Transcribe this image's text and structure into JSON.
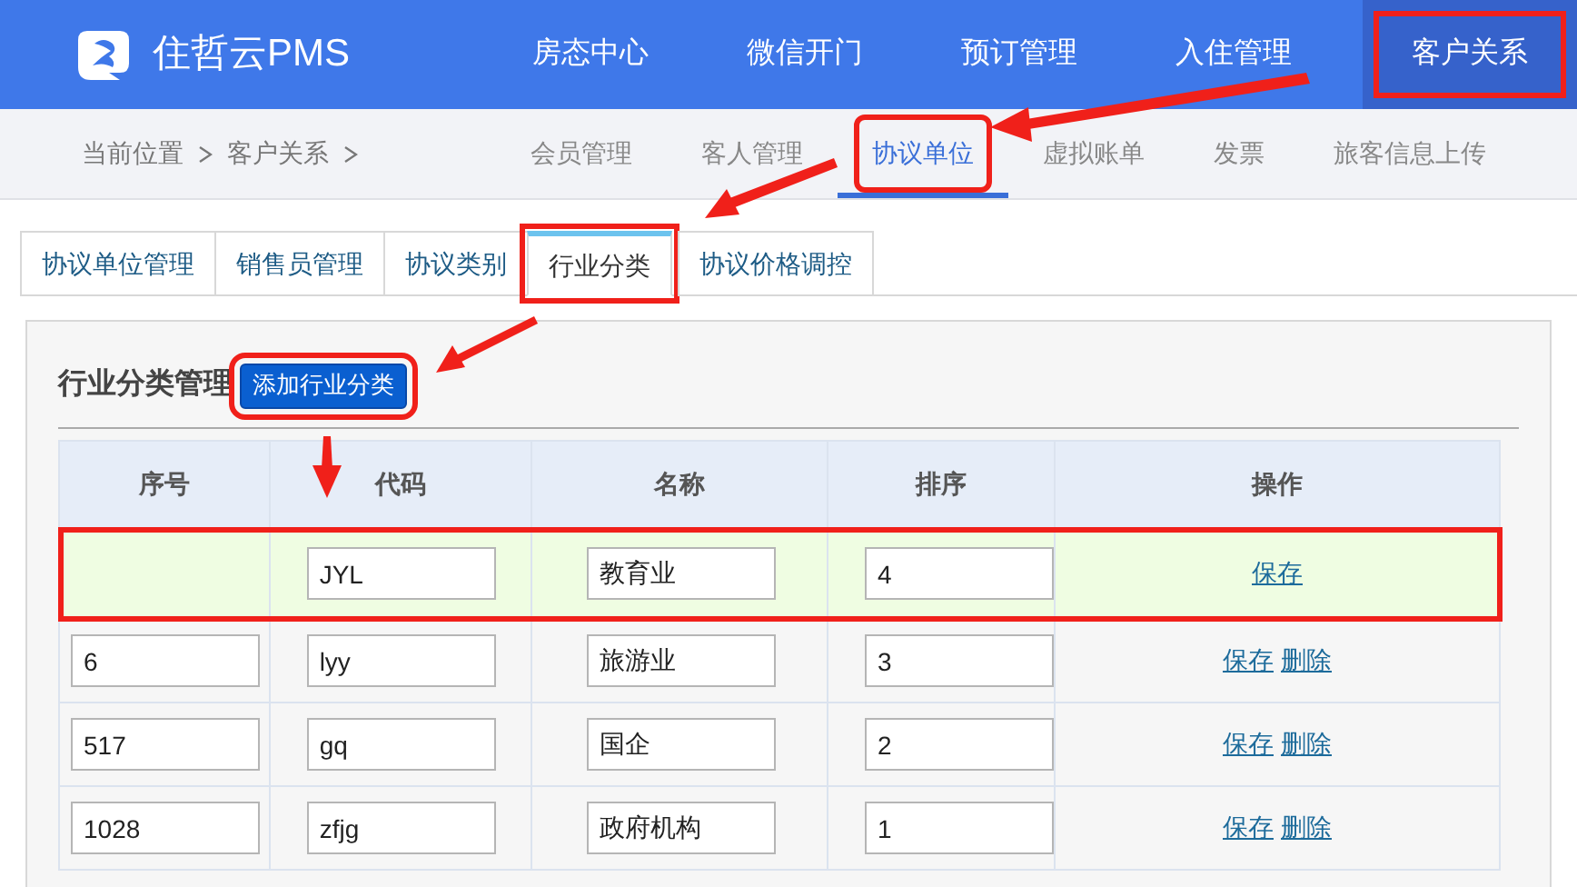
{
  "brand": {
    "name": "住哲云PMS"
  },
  "nav": [
    {
      "label": "房态中心",
      "selected": false,
      "annotated": false
    },
    {
      "label": "微信开门",
      "selected": false,
      "annotated": false
    },
    {
      "label": "预订管理",
      "selected": false,
      "annotated": false
    },
    {
      "label": "入住管理",
      "selected": false,
      "annotated": false
    },
    {
      "label": "客户关系",
      "selected": true,
      "annotated": true
    }
  ],
  "breadcrumb": [
    "当前位置",
    "客户关系"
  ],
  "subnav": [
    {
      "label": "会员管理",
      "selected": false,
      "annotated": false
    },
    {
      "label": "客人管理",
      "selected": false,
      "annotated": false
    },
    {
      "label": "协议单位",
      "selected": true,
      "annotated": true
    },
    {
      "label": "虚拟账单",
      "selected": false,
      "annotated": false
    },
    {
      "label": "发票",
      "selected": false,
      "annotated": false
    },
    {
      "label": "旅客信息上传",
      "selected": false,
      "annotated": false
    }
  ],
  "tabs": [
    {
      "label": "协议单位管理",
      "selected": false,
      "annotated": false
    },
    {
      "label": "销售员管理",
      "selected": false,
      "annotated": false
    },
    {
      "label": "协议类别",
      "selected": false,
      "annotated": false
    },
    {
      "label": "行业分类",
      "selected": true,
      "annotated": true
    },
    {
      "label": "协议价格调控",
      "selected": false,
      "annotated": false
    }
  ],
  "panel": {
    "title": "行业分类管理",
    "add_button": {
      "label": "添加行业分类",
      "annotated": true
    }
  },
  "table": {
    "columns": [
      "序号",
      "代码",
      "名称",
      "排序",
      "操作"
    ],
    "rows": [
      {
        "new": true,
        "annotated": true,
        "seq": "",
        "code": "JYL",
        "name": "教育业",
        "order": "4",
        "actions": [
          "保存"
        ]
      },
      {
        "new": false,
        "annotated": false,
        "seq": "6",
        "code": "lyy",
        "name": "旅游业",
        "order": "3",
        "actions": [
          "保存",
          "删除"
        ]
      },
      {
        "new": false,
        "annotated": false,
        "seq": "517",
        "code": "gq",
        "name": "国企",
        "order": "2",
        "actions": [
          "保存",
          "删除"
        ]
      },
      {
        "new": false,
        "annotated": false,
        "seq": "1028",
        "code": "zfjg",
        "name": "政府机构",
        "order": "1",
        "actions": [
          "保存",
          "删除"
        ]
      }
    ]
  }
}
